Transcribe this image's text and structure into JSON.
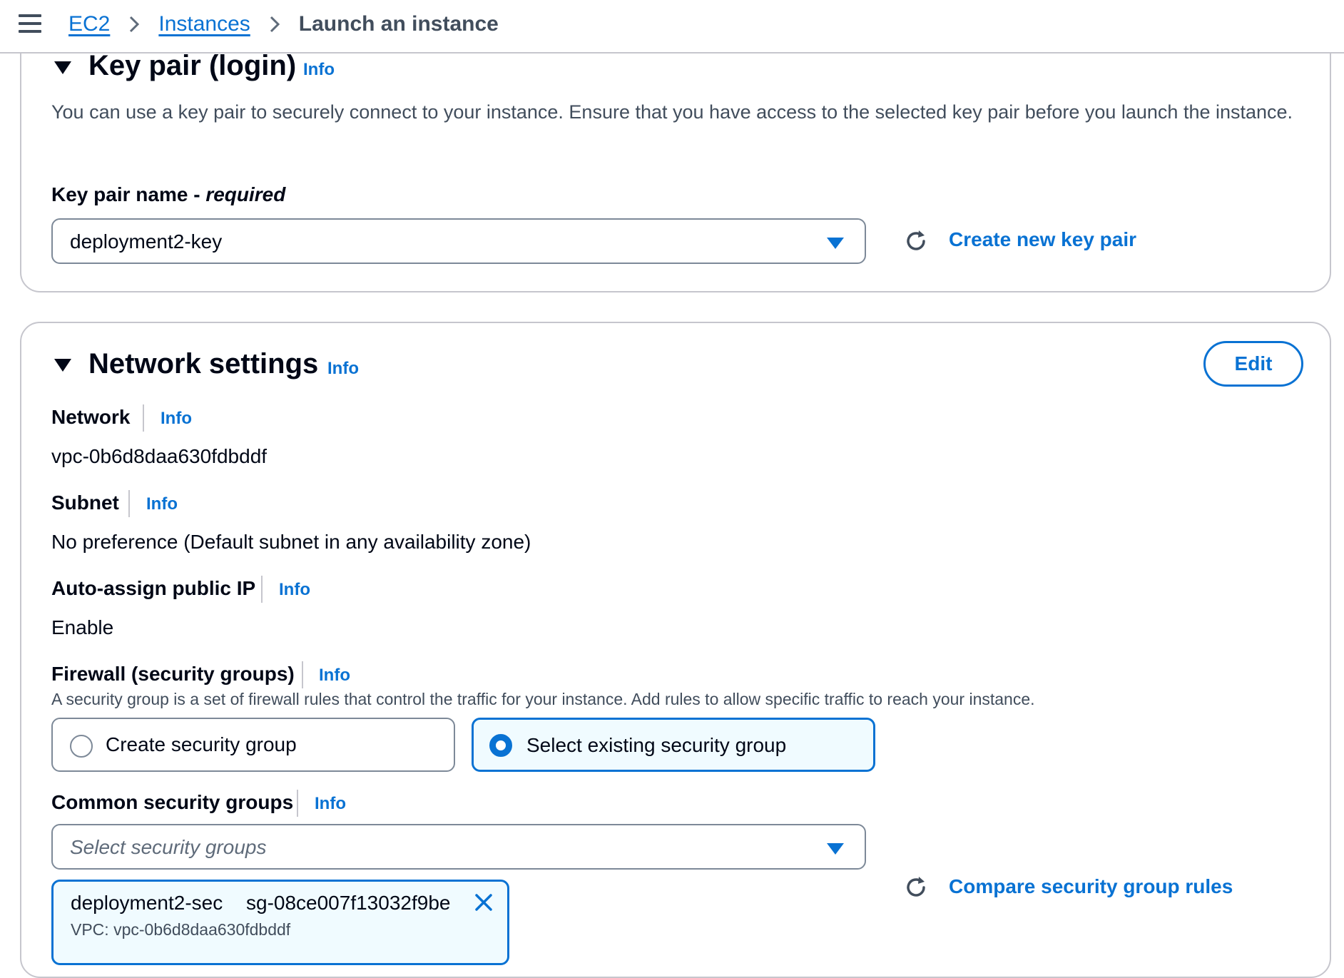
{
  "breadcrumb": {
    "items": [
      "EC2",
      "Instances"
    ],
    "current": "Launch an instance"
  },
  "key_pair": {
    "title": "Key pair (login)",
    "info": "Info",
    "description": "You can use a key pair to securely connect to your instance. Ensure that you have access to the selected key pair before you launch the instance.",
    "field_label": "Key pair name - ",
    "field_required": "required",
    "selected_value": "deployment2-key",
    "create_link": "Create new key pair"
  },
  "network": {
    "title": "Network settings",
    "info": "Info",
    "edit_button": "Edit",
    "network_label": "Network",
    "network_value": "vpc-0b6d8daa630fdbddf",
    "subnet_label": "Subnet",
    "subnet_value": "No preference (Default subnet in any availability zone)",
    "public_ip_label": "Auto-assign public IP",
    "public_ip_value": "Enable",
    "firewall_label": "Firewall (security groups)",
    "firewall_description": "A security group is a set of firewall rules that control the traffic for your instance. Add rules to allow specific traffic to reach your instance.",
    "firewall_options": [
      "Create security group",
      "Select existing security group"
    ],
    "firewall_selected": "Select existing security group",
    "common_sg_label": "Common security groups",
    "common_sg_placeholder": "Select security groups",
    "compare_link": "Compare security group rules",
    "selected_group": {
      "name": "deployment2-sec",
      "id": "sg-08ce007f13032f9be",
      "vpc": "VPC: vpc-0b6d8daa630fdbddf"
    }
  },
  "colors": {
    "link": "#0972d3",
    "text": "#000716",
    "secondary_text": "#414d5c",
    "border": "#c6c6cd",
    "selected_bg": "#f0fbff"
  }
}
